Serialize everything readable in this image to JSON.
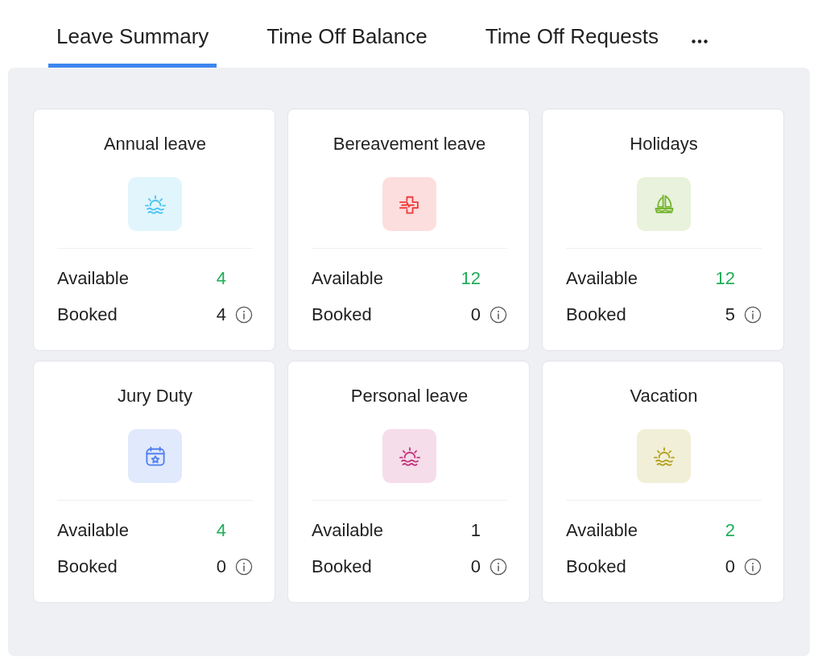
{
  "tabs": [
    {
      "label": "Leave Summary",
      "selected": true
    },
    {
      "label": "Time Off Balance",
      "selected": false
    },
    {
      "label": "Time Off Requests",
      "selected": false
    }
  ],
  "cards": [
    {
      "title": "Annual leave",
      "kind": "sunrise",
      "color": "#4cc3f0",
      "rows": [
        {
          "label": "Available",
          "value": "4",
          "highlighted": true,
          "info": false
        },
        {
          "label": "Booked",
          "value": "4",
          "highlighted": false,
          "info": true
        }
      ]
    },
    {
      "title": "Bereavement leave",
      "kind": "medical",
      "color": "#ef3b3b",
      "rows": [
        {
          "label": "Available",
          "value": "12",
          "highlighted": true,
          "info": false
        },
        {
          "label": "Booked",
          "value": "0",
          "highlighted": false,
          "info": true
        }
      ]
    },
    {
      "title": "Holidays",
      "kind": "sailboat",
      "color": "#77b530",
      "rows": [
        {
          "label": "Available",
          "value": "12",
          "highlighted": true,
          "info": false
        },
        {
          "label": "Booked",
          "value": "5",
          "highlighted": false,
          "info": true
        }
      ]
    },
    {
      "title": "Jury Duty",
      "kind": "calendar",
      "color": "#4f7ff0",
      "rows": [
        {
          "label": "Available",
          "value": "4",
          "highlighted": true,
          "info": false
        },
        {
          "label": "Booked",
          "value": "0",
          "highlighted": false,
          "info": true
        }
      ]
    },
    {
      "title": "Personal leave",
      "kind": "sunrise",
      "color": "#c2377f",
      "rows": [
        {
          "label": "Available",
          "value": "1",
          "highlighted": false,
          "info": false
        },
        {
          "label": "Booked",
          "value": "0",
          "highlighted": false,
          "info": true
        }
      ]
    },
    {
      "title": "Vacation",
      "kind": "sunrise",
      "color": "#b3a21f",
      "rows": [
        {
          "label": "Available",
          "value": "2",
          "highlighted": true,
          "info": false
        },
        {
          "label": "Booked",
          "value": "0",
          "highlighted": false,
          "info": true
        }
      ]
    }
  ]
}
